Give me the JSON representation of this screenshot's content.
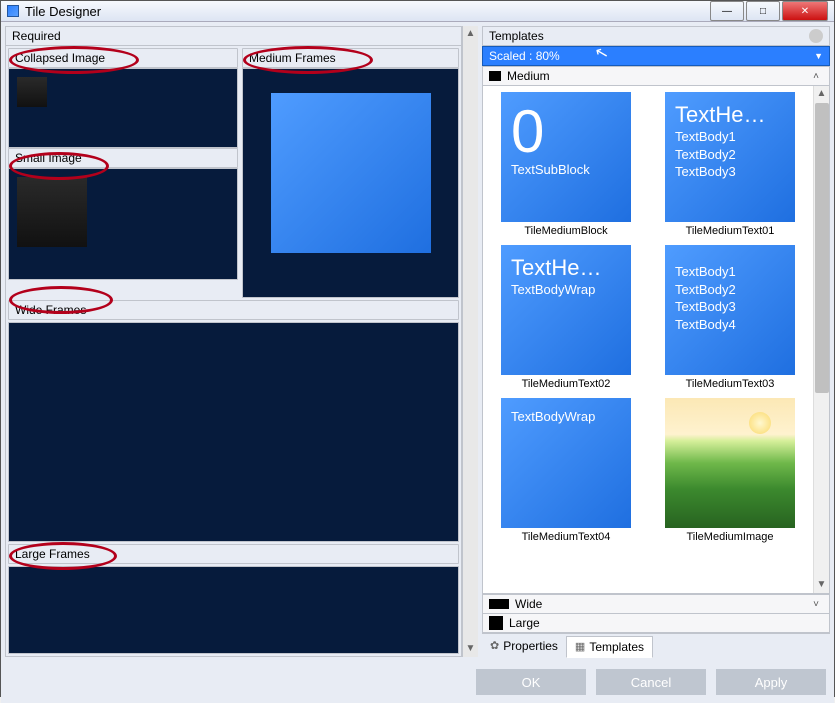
{
  "window": {
    "title": "Tile Designer"
  },
  "left": {
    "panel_title": "Required",
    "sections": {
      "collapsed": "Collapsed Image",
      "small": "Small Image",
      "medium": "Medium Frames",
      "wide": "Wide Frames",
      "large": "Large Frames"
    }
  },
  "right": {
    "panel_title": "Templates",
    "scaled_label": "Scaled : 80%",
    "groups": {
      "medium": "Medium",
      "wide": "Wide",
      "large": "Large"
    }
  },
  "templates": [
    {
      "caption": "TileMediumBlock",
      "kind": "block",
      "big": "0",
      "sub": "TextSubBlock"
    },
    {
      "caption": "TileMediumText01",
      "kind": "text01",
      "header": "TextHe…",
      "lines": [
        "TextBody1",
        "TextBody2",
        "TextBody3"
      ]
    },
    {
      "caption": "TileMediumText02",
      "kind": "text02",
      "header": "TextHe…",
      "wrap": "TextBodyWrap"
    },
    {
      "caption": "TileMediumText03",
      "kind": "text03",
      "lines": [
        "TextBody1",
        "TextBody2",
        "TextBody3",
        "TextBody4"
      ]
    },
    {
      "caption": "TileMediumText04",
      "kind": "text04",
      "wrap": "TextBodyWrap"
    },
    {
      "caption": "TileMediumImage",
      "kind": "image"
    }
  ],
  "tabs": {
    "properties": "Properties",
    "templates": "Templates"
  },
  "buttons": {
    "ok": "OK",
    "cancel": "Cancel",
    "apply": "Apply"
  }
}
